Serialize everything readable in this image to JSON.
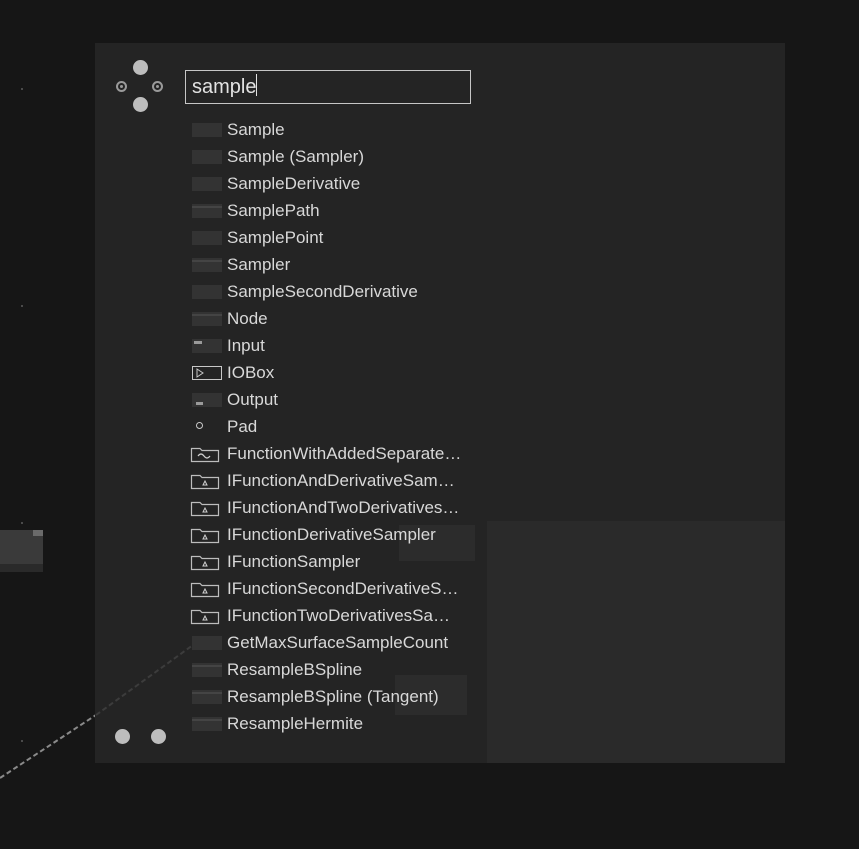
{
  "search": {
    "value": "sample"
  },
  "results": [
    {
      "label": "Sample",
      "icon": "box-icon"
    },
    {
      "label": "Sample (Sampler)",
      "icon": "box-icon"
    },
    {
      "label": "SampleDerivative",
      "icon": "box-icon"
    },
    {
      "label": "SamplePath",
      "icon": "box-icon"
    },
    {
      "label": "SamplePoint",
      "icon": "box-icon"
    },
    {
      "label": "Sampler",
      "icon": "box-icon"
    },
    {
      "label": "SampleSecondDerivative",
      "icon": "box-icon"
    },
    {
      "label": "Node",
      "icon": "box-icon"
    },
    {
      "label": "Input",
      "icon": "input-icon"
    },
    {
      "label": "IOBox",
      "icon": "iobox-icon"
    },
    {
      "label": "Output",
      "icon": "output-icon"
    },
    {
      "label": "Pad",
      "icon": "pad-icon"
    },
    {
      "label": "FunctionWithAddedSeparate…",
      "icon": "folder-function-icon"
    },
    {
      "label": "IFunctionAndDerivativeSam…",
      "icon": "folder-interface-icon"
    },
    {
      "label": "IFunctionAndTwoDerivatives…",
      "icon": "folder-interface-icon"
    },
    {
      "label": "IFunctionDerivativeSampler",
      "icon": "folder-interface-icon"
    },
    {
      "label": "IFunctionSampler",
      "icon": "folder-interface-icon"
    },
    {
      "label": "IFunctionSecondDerivativeS…",
      "icon": "folder-interface-icon"
    },
    {
      "label": "IFunctionTwoDerivativesSa…",
      "icon": "folder-interface-icon"
    },
    {
      "label": "GetMaxSurfaceSampleCount",
      "icon": "box-icon"
    },
    {
      "label": "ResampleBSpline",
      "icon": "box-icon"
    },
    {
      "label": "ResampleBSpline (Tangent)",
      "icon": "box-icon"
    },
    {
      "label": "ResampleHermite",
      "icon": "box-icon"
    }
  ],
  "colors": {
    "canvas": "#161616",
    "panel": "#242424",
    "text": "#d8d8d8",
    "accent_dot": "#bdbdbd"
  }
}
